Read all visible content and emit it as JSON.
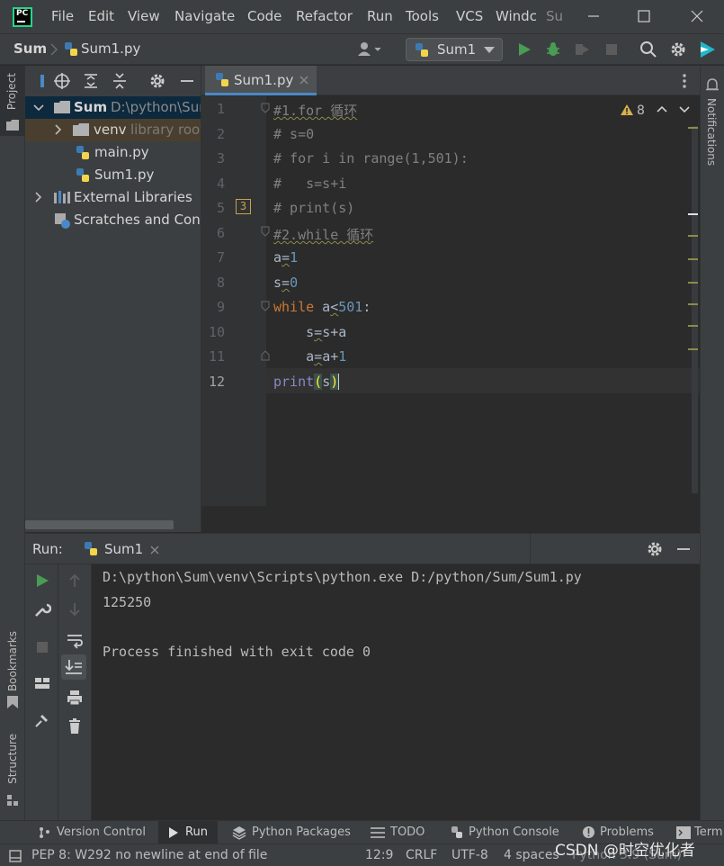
{
  "menu": [
    "File",
    "Edit",
    "View",
    "Navigate",
    "Code",
    "Refactor",
    "Run",
    "Tools",
    "VCS",
    "Windc",
    "Su"
  ],
  "app_logo_text": "PC",
  "breadcrumb": {
    "project": "Sum",
    "file": "Sum1.py"
  },
  "run_config": "Sum1",
  "left_strip": {
    "project": "Project",
    "bookmarks": "Bookmarks",
    "structure": "Structure"
  },
  "right_strip": {
    "notifications": "Notifications"
  },
  "project_tree": {
    "root_name": "Sum",
    "root_path": "D:\\python\\Sum",
    "venv_name": "venv",
    "venv_hint": "library root",
    "file1": "main.py",
    "file2": "Sum1.py",
    "external": "External Libraries",
    "scratches": "Scratches and Consoles"
  },
  "editor": {
    "tab_label": "Sum1.py",
    "warnings_count": "8",
    "bookmark_mark": "3",
    "line_numbers": [
      "1",
      "2",
      "3",
      "4",
      "5",
      "6",
      "7",
      "8",
      "9",
      "10",
      "11",
      "12"
    ],
    "current_line": "12"
  },
  "run_panel": {
    "label": "Run:",
    "tab": "Sum1",
    "output": [
      "D:\\python\\Sum\\venv\\Scripts\\python.exe D:/python/Sum/Sum1.py",
      "125250",
      "",
      "Process finished with exit code 0"
    ]
  },
  "bottom_tabs": [
    "Version Control",
    "Run",
    "Python Packages",
    "TODO",
    "Python Console",
    "Problems",
    "Term"
  ],
  "status": {
    "message": "PEP 8: W292 no newline at end of file",
    "position": "12:9",
    "line_sep": "CRLF",
    "encoding": "UTF-8",
    "indent": "4 spaces",
    "interpreter": "Python 3.9 (Sum)",
    "watermark": "CSDN @时空优化者"
  },
  "colors": {
    "accent": "#4a88c7",
    "keyword": "#cc7832",
    "number": "#6897bb",
    "comment": "#808080",
    "run_green": "#499c54"
  }
}
